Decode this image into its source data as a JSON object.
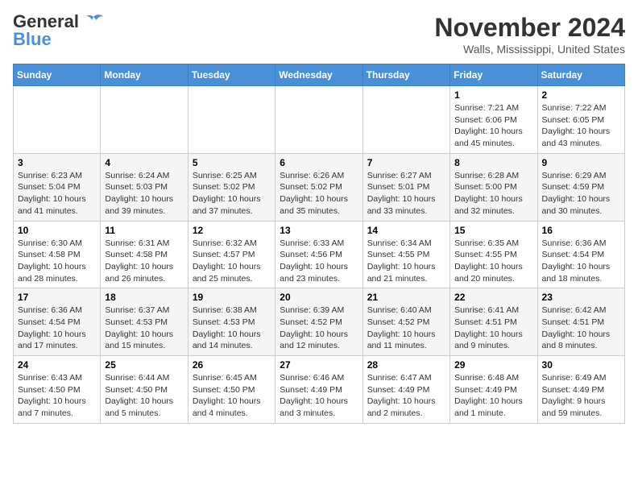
{
  "header": {
    "logo_general": "General",
    "logo_blue": "Blue",
    "month": "November 2024",
    "location": "Walls, Mississippi, United States"
  },
  "weekdays": [
    "Sunday",
    "Monday",
    "Tuesday",
    "Wednesday",
    "Thursday",
    "Friday",
    "Saturday"
  ],
  "weeks": [
    [
      {
        "day": "",
        "info": ""
      },
      {
        "day": "",
        "info": ""
      },
      {
        "day": "",
        "info": ""
      },
      {
        "day": "",
        "info": ""
      },
      {
        "day": "",
        "info": ""
      },
      {
        "day": "1",
        "info": "Sunrise: 7:21 AM\nSunset: 6:06 PM\nDaylight: 10 hours and 45 minutes."
      },
      {
        "day": "2",
        "info": "Sunrise: 7:22 AM\nSunset: 6:05 PM\nDaylight: 10 hours and 43 minutes."
      }
    ],
    [
      {
        "day": "3",
        "info": "Sunrise: 6:23 AM\nSunset: 5:04 PM\nDaylight: 10 hours and 41 minutes."
      },
      {
        "day": "4",
        "info": "Sunrise: 6:24 AM\nSunset: 5:03 PM\nDaylight: 10 hours and 39 minutes."
      },
      {
        "day": "5",
        "info": "Sunrise: 6:25 AM\nSunset: 5:02 PM\nDaylight: 10 hours and 37 minutes."
      },
      {
        "day": "6",
        "info": "Sunrise: 6:26 AM\nSunset: 5:02 PM\nDaylight: 10 hours and 35 minutes."
      },
      {
        "day": "7",
        "info": "Sunrise: 6:27 AM\nSunset: 5:01 PM\nDaylight: 10 hours and 33 minutes."
      },
      {
        "day": "8",
        "info": "Sunrise: 6:28 AM\nSunset: 5:00 PM\nDaylight: 10 hours and 32 minutes."
      },
      {
        "day": "9",
        "info": "Sunrise: 6:29 AM\nSunset: 4:59 PM\nDaylight: 10 hours and 30 minutes."
      }
    ],
    [
      {
        "day": "10",
        "info": "Sunrise: 6:30 AM\nSunset: 4:58 PM\nDaylight: 10 hours and 28 minutes."
      },
      {
        "day": "11",
        "info": "Sunrise: 6:31 AM\nSunset: 4:58 PM\nDaylight: 10 hours and 26 minutes."
      },
      {
        "day": "12",
        "info": "Sunrise: 6:32 AM\nSunset: 4:57 PM\nDaylight: 10 hours and 25 minutes."
      },
      {
        "day": "13",
        "info": "Sunrise: 6:33 AM\nSunset: 4:56 PM\nDaylight: 10 hours and 23 minutes."
      },
      {
        "day": "14",
        "info": "Sunrise: 6:34 AM\nSunset: 4:55 PM\nDaylight: 10 hours and 21 minutes."
      },
      {
        "day": "15",
        "info": "Sunrise: 6:35 AM\nSunset: 4:55 PM\nDaylight: 10 hours and 20 minutes."
      },
      {
        "day": "16",
        "info": "Sunrise: 6:36 AM\nSunset: 4:54 PM\nDaylight: 10 hours and 18 minutes."
      }
    ],
    [
      {
        "day": "17",
        "info": "Sunrise: 6:36 AM\nSunset: 4:54 PM\nDaylight: 10 hours and 17 minutes."
      },
      {
        "day": "18",
        "info": "Sunrise: 6:37 AM\nSunset: 4:53 PM\nDaylight: 10 hours and 15 minutes."
      },
      {
        "day": "19",
        "info": "Sunrise: 6:38 AM\nSunset: 4:53 PM\nDaylight: 10 hours and 14 minutes."
      },
      {
        "day": "20",
        "info": "Sunrise: 6:39 AM\nSunset: 4:52 PM\nDaylight: 10 hours and 12 minutes."
      },
      {
        "day": "21",
        "info": "Sunrise: 6:40 AM\nSunset: 4:52 PM\nDaylight: 10 hours and 11 minutes."
      },
      {
        "day": "22",
        "info": "Sunrise: 6:41 AM\nSunset: 4:51 PM\nDaylight: 10 hours and 9 minutes."
      },
      {
        "day": "23",
        "info": "Sunrise: 6:42 AM\nSunset: 4:51 PM\nDaylight: 10 hours and 8 minutes."
      }
    ],
    [
      {
        "day": "24",
        "info": "Sunrise: 6:43 AM\nSunset: 4:50 PM\nDaylight: 10 hours and 7 minutes."
      },
      {
        "day": "25",
        "info": "Sunrise: 6:44 AM\nSunset: 4:50 PM\nDaylight: 10 hours and 5 minutes."
      },
      {
        "day": "26",
        "info": "Sunrise: 6:45 AM\nSunset: 4:50 PM\nDaylight: 10 hours and 4 minutes."
      },
      {
        "day": "27",
        "info": "Sunrise: 6:46 AM\nSunset: 4:49 PM\nDaylight: 10 hours and 3 minutes."
      },
      {
        "day": "28",
        "info": "Sunrise: 6:47 AM\nSunset: 4:49 PM\nDaylight: 10 hours and 2 minutes."
      },
      {
        "day": "29",
        "info": "Sunrise: 6:48 AM\nSunset: 4:49 PM\nDaylight: 10 hours and 1 minute."
      },
      {
        "day": "30",
        "info": "Sunrise: 6:49 AM\nSunset: 4:49 PM\nDaylight: 9 hours and 59 minutes."
      }
    ]
  ]
}
